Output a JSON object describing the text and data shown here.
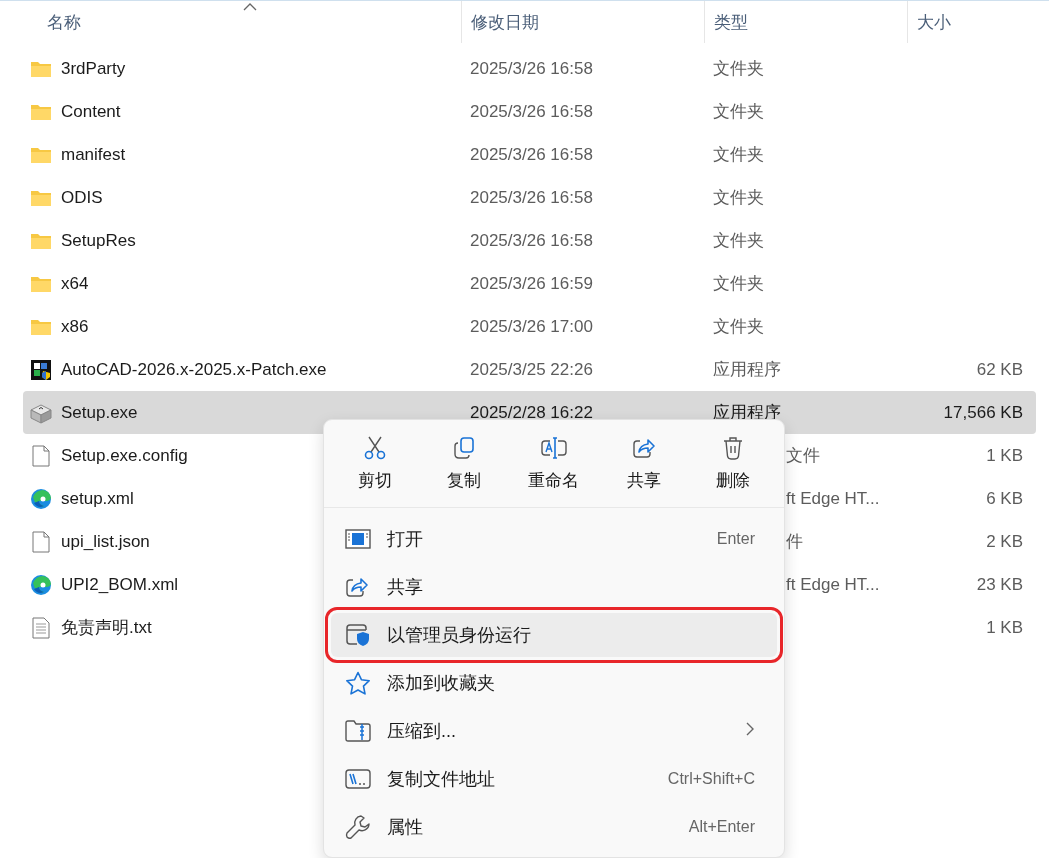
{
  "table": {
    "columns": [
      {
        "label": "名称",
        "sorted": true
      },
      {
        "label": "修改日期",
        "sorted": false
      },
      {
        "label": "类型",
        "sorted": false
      },
      {
        "label": "大小",
        "sorted": false
      }
    ],
    "rows": [
      {
        "kind": "folder",
        "name": "3rdParty",
        "date": "2025/3/26 16:58",
        "type": "文件夹",
        "selected": false
      },
      {
        "kind": "folder",
        "name": "Content",
        "date": "2025/3/26 16:58",
        "type": "文件夹",
        "selected": false
      },
      {
        "kind": "folder",
        "name": "manifest",
        "date": "2025/3/26 16:58",
        "type": "文件夹",
        "selected": false
      },
      {
        "kind": "folder",
        "name": "ODIS",
        "date": "2025/3/26 16:58",
        "type": "文件夹",
        "selected": false
      },
      {
        "kind": "folder",
        "name": "SetupRes",
        "date": "2025/3/26 16:58",
        "type": "文件夹",
        "selected": false
      },
      {
        "kind": "folder",
        "name": "x64",
        "date": "2025/3/26 16:59",
        "type": "文件夹",
        "selected": false
      },
      {
        "kind": "folder",
        "name": "x86",
        "date": "2025/3/26 17:00",
        "type": "文件夹",
        "selected": false
      },
      {
        "kind": "patch",
        "name": "AutoCAD-2026.x-2025.x-Patch.exe",
        "date": "2025/3/25 22:26",
        "type": "应用程序",
        "size": "62 KB",
        "selected": false
      },
      {
        "kind": "installer",
        "name": "Setup.exe",
        "date": "2025/2/28 16:22",
        "type": "应用程序",
        "size": "17,566 KB",
        "selected": true
      },
      {
        "kind": "file",
        "name": "Setup.exe.config",
        "type": "文件",
        "size": "1 KB",
        "selected": false
      },
      {
        "kind": "edge",
        "name": "setup.xml",
        "type": "ft Edge HT...",
        "size": "6 KB",
        "selected": false
      },
      {
        "kind": "file",
        "name": "upi_list.json",
        "type": "件",
        "size": "2 KB",
        "selected": false
      },
      {
        "kind": "edge",
        "name": "UPI2_BOM.xml",
        "type": "ft Edge HT...",
        "size": "23 KB",
        "selected": false
      },
      {
        "kind": "text",
        "name": "免责声明.txt",
        "size": "1 KB",
        "selected": false
      }
    ]
  },
  "context_menu": {
    "actions": [
      {
        "kind": "cut",
        "label": "剪切"
      },
      {
        "kind": "copy",
        "label": "复制"
      },
      {
        "kind": "rename",
        "label": "重命名"
      },
      {
        "kind": "share",
        "label": "共享"
      },
      {
        "kind": "delete",
        "label": "删除"
      }
    ],
    "items": [
      {
        "kind": "open",
        "label": "打开",
        "shortcut": "Enter",
        "selected": false
      },
      {
        "kind": "share",
        "label": "共享",
        "selected": false
      },
      {
        "kind": "admin",
        "label": "以管理员身份运行",
        "selected": true
      },
      {
        "kind": "favorite",
        "label": "添加到收藏夹",
        "selected": false
      },
      {
        "kind": "zip",
        "label": "压缩到...",
        "submenu": true,
        "selected": false
      },
      {
        "kind": "path",
        "label": "复制文件地址",
        "shortcut": "Ctrl+Shift+C",
        "selected": false
      },
      {
        "kind": "properties",
        "label": "属性",
        "shortcut": "Alt+Enter",
        "selected": false
      }
    ]
  }
}
